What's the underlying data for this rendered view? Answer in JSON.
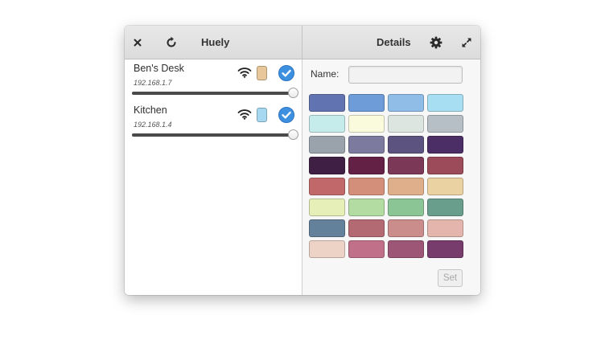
{
  "window": {
    "title": "Huely",
    "details_title": "Details"
  },
  "devices": [
    {
      "name": "Ben's Desk",
      "ip": "192.168.1.7",
      "color": "#e8c89a",
      "checked": true,
      "brightness": 1.0
    },
    {
      "name": "Kitchen",
      "ip": "192.168.1.4",
      "color": "#a6d8f2",
      "checked": true,
      "brightness": 1.0
    }
  ],
  "details": {
    "name_label": "Name:",
    "name_value": "",
    "set_label": "Set",
    "palette": [
      "#6173b0",
      "#6d9cd8",
      "#8fbde8",
      "#a7def2",
      "#c5ebea",
      "#f9fbdc",
      "#dce5e0",
      "#b7bfc6",
      "#9aa2ab",
      "#7c7b9f",
      "#5d5380",
      "#4c2e66",
      "#3f1f44",
      "#632146",
      "#7c3857",
      "#9b4b5a",
      "#c1686b",
      "#d48f7a",
      "#dfae8a",
      "#ebd2a2",
      "#e7efb9",
      "#b3dca3",
      "#8bc495",
      "#6a9e8c",
      "#64819b",
      "#b46a73",
      "#cb8d8b",
      "#e3b5ac",
      "#ecd3c6",
      "#c07088",
      "#9d5676",
      "#773c6c"
    ]
  },
  "colors": {
    "accent": "#3d8fe0",
    "headerbar": "#e0e0e0"
  },
  "icons": {
    "close": "close-icon",
    "refresh": "refresh-icon",
    "settings": "gear-icon",
    "maximize": "maximize-icon",
    "wifi": "wifi-icon",
    "check": "check-icon"
  }
}
